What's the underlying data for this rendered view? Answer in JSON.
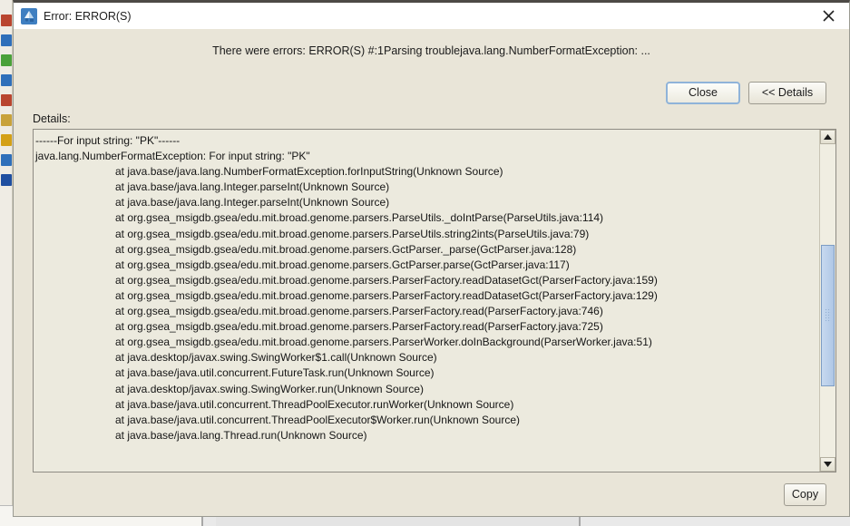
{
  "window": {
    "title": "Error: ERROR(S)",
    "icon": "gsea-app-icon",
    "close_icon": "close-icon"
  },
  "message": {
    "text": "There were errors: ERROR(S) #:1Parsing troublejava.lang.NumberFormatException: ..."
  },
  "buttons": {
    "close_label": "Close",
    "details_toggle_label": "<< Details",
    "copy_label": "Copy"
  },
  "details": {
    "label": "Details:",
    "lines": [
      {
        "indent": false,
        "text": "------For input string: \"PK\"------"
      },
      {
        "indent": false,
        "text": "java.lang.NumberFormatException: For input string: \"PK\""
      },
      {
        "indent": true,
        "text": "at java.base/java.lang.NumberFormatException.forInputString(Unknown Source)"
      },
      {
        "indent": true,
        "text": "at java.base/java.lang.Integer.parseInt(Unknown Source)"
      },
      {
        "indent": true,
        "text": "at java.base/java.lang.Integer.parseInt(Unknown Source)"
      },
      {
        "indent": true,
        "text": "at org.gsea_msigdb.gsea/edu.mit.broad.genome.parsers.ParseUtils._doIntParse(ParseUtils.java:114)"
      },
      {
        "indent": true,
        "text": "at org.gsea_msigdb.gsea/edu.mit.broad.genome.parsers.ParseUtils.string2ints(ParseUtils.java:79)"
      },
      {
        "indent": true,
        "text": "at org.gsea_msigdb.gsea/edu.mit.broad.genome.parsers.GctParser._parse(GctParser.java:128)"
      },
      {
        "indent": true,
        "text": "at org.gsea_msigdb.gsea/edu.mit.broad.genome.parsers.GctParser.parse(GctParser.java:117)"
      },
      {
        "indent": true,
        "text": "at org.gsea_msigdb.gsea/edu.mit.broad.genome.parsers.ParserFactory.readDatasetGct(ParserFactory.java:159)"
      },
      {
        "indent": true,
        "text": "at org.gsea_msigdb.gsea/edu.mit.broad.genome.parsers.ParserFactory.readDatasetGct(ParserFactory.java:129)"
      },
      {
        "indent": true,
        "text": "at org.gsea_msigdb.gsea/edu.mit.broad.genome.parsers.ParserFactory.read(ParserFactory.java:746)"
      },
      {
        "indent": true,
        "text": "at org.gsea_msigdb.gsea/edu.mit.broad.genome.parsers.ParserFactory.read(ParserFactory.java:725)"
      },
      {
        "indent": true,
        "text": "at org.gsea_msigdb.gsea/edu.mit.broad.genome.parsers.ParserWorker.doInBackground(ParserWorker.java:51)"
      },
      {
        "indent": true,
        "text": "at java.desktop/javax.swing.SwingWorker$1.call(Unknown Source)"
      },
      {
        "indent": true,
        "text": "at java.base/java.util.concurrent.FutureTask.run(Unknown Source)"
      },
      {
        "indent": true,
        "text": "at java.desktop/javax.swing.SwingWorker.run(Unknown Source)"
      },
      {
        "indent": true,
        "text": "at java.base/java.util.concurrent.ThreadPoolExecutor.runWorker(Unknown Source)"
      },
      {
        "indent": true,
        "text": "at java.base/java.util.concurrent.ThreadPoolExecutor$Worker.run(Unknown Source)"
      },
      {
        "indent": true,
        "text": "at java.base/java.lang.Thread.run(Unknown Source)"
      }
    ]
  },
  "scrollbar": {
    "up_arrow_icon": "triangle-up-icon",
    "down_arrow_icon": "triangle-down-icon"
  },
  "colors": {
    "dialog_background": "#e9e5d8",
    "titlebar_background": "#ffffff",
    "text_area_background": "#eceade",
    "focus_border": "#8fb3d9",
    "scroll_thumb": "#b9cfea",
    "background_accent": "#e8736a"
  },
  "background_app": {
    "left_icons": [
      "#b9452f",
      "#2f6fba",
      "#4aa13a",
      "#2f6fba",
      "#b9452f",
      "#c8a23b",
      "#d4a017",
      "#2f6fba",
      "#1f4fa0"
    ]
  }
}
